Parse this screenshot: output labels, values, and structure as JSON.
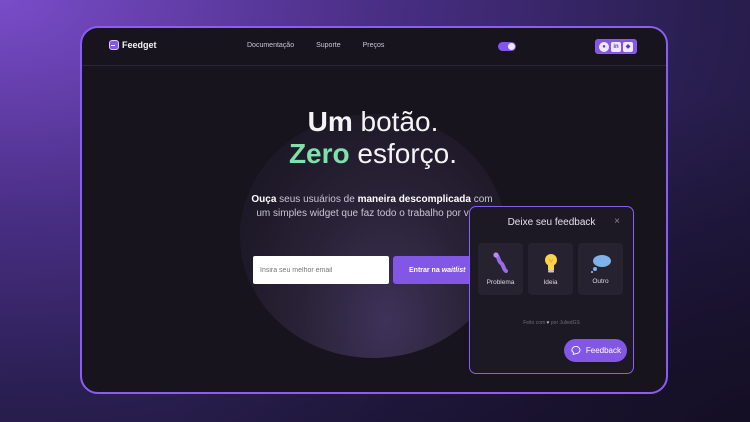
{
  "brand": {
    "name": "Feedget",
    "logo_icon": "chat-square-icon"
  },
  "nav": {
    "items": [
      "Documentação",
      "Suporte",
      "Preços"
    ]
  },
  "theme_toggle": {
    "state": "dark",
    "accent": "#8257e5"
  },
  "socials": {
    "items": [
      "github-icon",
      "linkedin-icon",
      "figma-icon"
    ]
  },
  "hero": {
    "line1_bold": "Um",
    "line1_rest": " botão.",
    "line2_accent": "Zero",
    "line2_rest": " esforço.",
    "accent_color": "#7ee0ab",
    "sub_b1": "Ouça",
    "sub_t1": " seus usuários de ",
    "sub_b2": "maneira descomplicada",
    "sub_t2": " com um simples widget que faz todo o trabalho por você!"
  },
  "waitlist": {
    "email_placeholder": "Insira seu melhor email",
    "button_prefix": "Entrar na ",
    "button_italic": "waitlist"
  },
  "widget": {
    "title": "Deixe seu feedback",
    "close_symbol": "×",
    "options": [
      {
        "label": "Problema",
        "icon": "bug-icon"
      },
      {
        "label": "Ideia",
        "icon": "lightbulb-icon"
      },
      {
        "label": "Outro",
        "icon": "thought-bubble-icon"
      }
    ],
    "footer_prefix": "Feito com ",
    "footer_heart": "♥",
    "footer_suffix": " por JuliedGS",
    "feedback_button": "Feedback"
  }
}
